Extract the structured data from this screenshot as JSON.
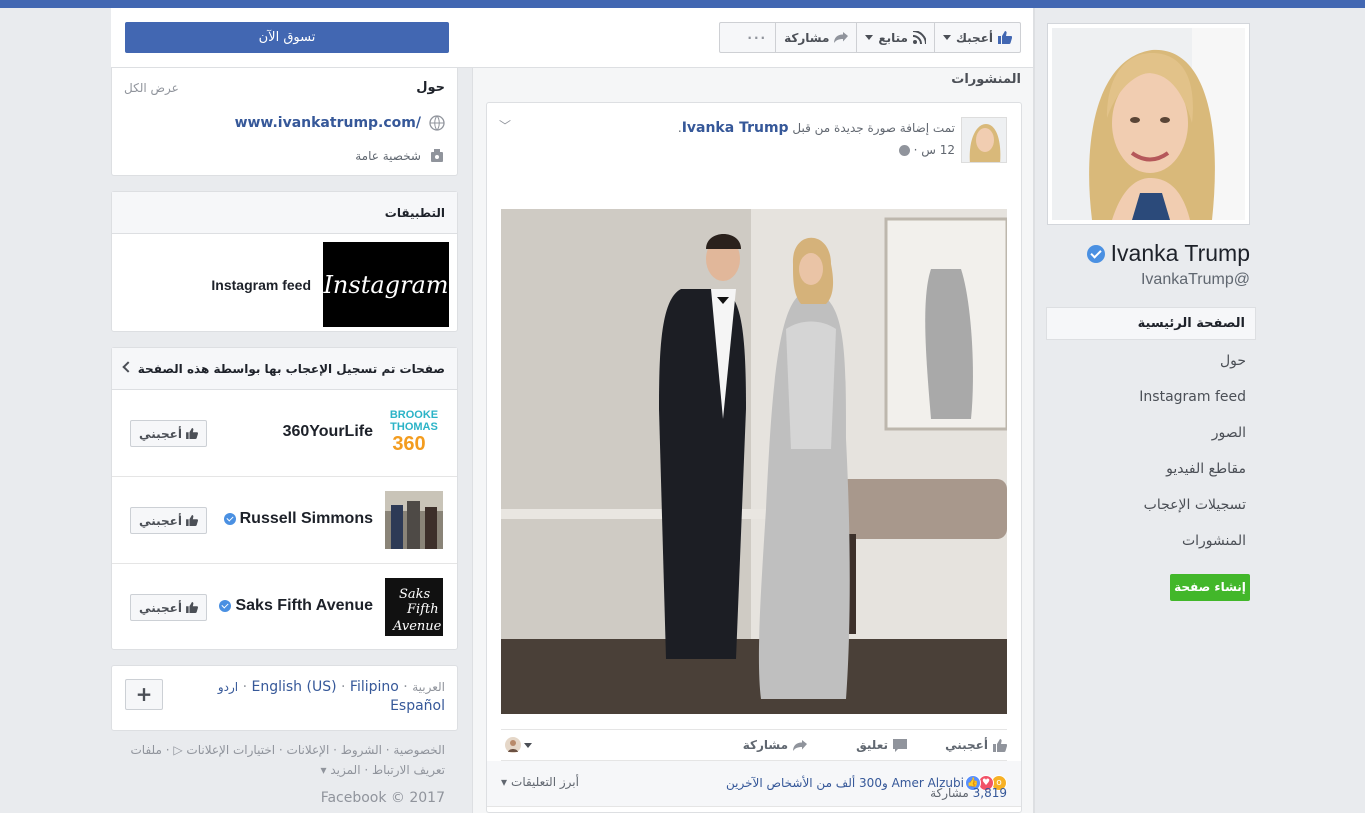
{
  "header": {
    "shop_now": "تسوق الآن",
    "like_label": "أعجبك",
    "follow_label": "متابع",
    "share_label": "مشاركة",
    "more_label": "···"
  },
  "profile": {
    "name": "Ivanka Trump",
    "username": "IvankaTrump@",
    "nav": [
      {
        "label": "الصفحة الرئيسية"
      },
      {
        "label": "حول"
      },
      {
        "label": "Instagram feed"
      },
      {
        "label": "الصور"
      },
      {
        "label": "مقاطع الفيديو"
      },
      {
        "label": "تسجيلات الإعجاب"
      },
      {
        "label": "المنشورات"
      }
    ],
    "create_page": "إنشاء صفحة"
  },
  "posts": {
    "title": "المنشورات",
    "post": {
      "author": "Ivanka Trump",
      "action_text": "تمت إضافة صورة جديدة من قبل",
      "time": "12 س ·",
      "like": "أعجبني",
      "comment": "تعليق",
      "share": "مشاركة",
      "reactions_text": "Amer Alzubi و300 ألف من الأشخاص الآخرين",
      "top_comments": "أبرز التعليقات",
      "shares_count": "3,819",
      "shares_label": "مشاركة"
    }
  },
  "about": {
    "title": "حول",
    "see_all": "عرض الكل",
    "website": "www.ivankatrump.com/",
    "category": "شخصية عامة"
  },
  "apps": {
    "title": "التطبيقات",
    "items": [
      {
        "name": "Instagram feed",
        "tile_text": "Instagram"
      }
    ]
  },
  "liked_pages": {
    "title": "صفحات تم تسجيل الإعجاب بها بواسطة هذه الصفحة",
    "like_button": "أعجبني",
    "items": [
      {
        "name": "360YourLife",
        "verified": false
      },
      {
        "name": "Russell Simmons",
        "verified": true
      },
      {
        "name": "Saks Fifth Avenue",
        "verified": true
      }
    ]
  },
  "languages": {
    "current": "العربية",
    "sep": "·",
    "others": [
      "English (US)",
      "Filipino",
      "اردو",
      "Español"
    ]
  },
  "footer": {
    "line1": "الخصوصية · الشروط · الإعلانات · اختيارات الإعلانات ▷ · ملفات",
    "line2": "تعريف الارتباط · المزيد ▾",
    "copyright": "Facebook © 2017"
  },
  "colors": {
    "fb_blue": "#4267b2",
    "link": "#365899",
    "green": "#42b72a",
    "background": "#e9ebee"
  }
}
